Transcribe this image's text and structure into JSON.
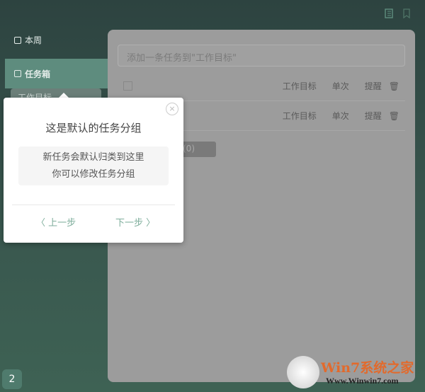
{
  "toolbar": {
    "icons": [
      "list-icon",
      "bookmark-icon"
    ]
  },
  "sidebar": {
    "items": [
      {
        "label": "本周"
      },
      {
        "label": "任务箱"
      }
    ],
    "sub_item": "工作目标"
  },
  "main": {
    "input_placeholder": "添加一条任务到\"工作目标\"",
    "rows": [
      {
        "title": "",
        "group": "工作目标",
        "repeat": "单次",
        "remind": "提醒"
      },
      {
        "title": "",
        "group": "工作目标",
        "repeat": "单次",
        "remind": "提醒"
      }
    ],
    "group_badge": "(0)"
  },
  "popup": {
    "title": "这是默认的任务分组",
    "line1": "新任务会默认归类到这里",
    "line2": "你可以修改任务分组",
    "prev": "〈 上一步",
    "next": "下一步 〉",
    "close": "×"
  },
  "badge": "2",
  "watermark": {
    "brand": "Win7系统之家",
    "url": "Www.Winwin7.com"
  },
  "colors": {
    "accent": "#5e8c7e",
    "link": "#7fae9c"
  }
}
